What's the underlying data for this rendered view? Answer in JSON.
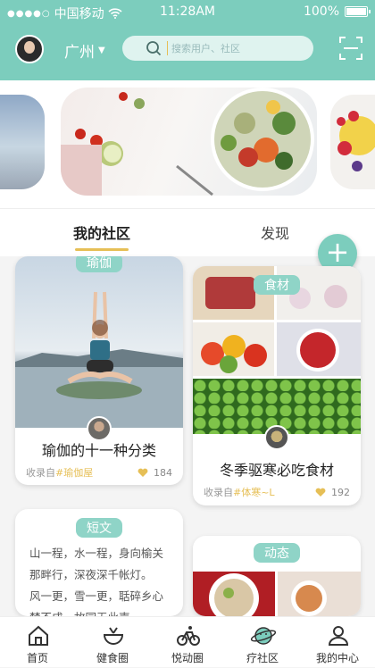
{
  "status_bar": {
    "carrier": "中国移动",
    "time": "11:28AM",
    "battery": "100%"
  },
  "header": {
    "city": "广州",
    "search_placeholder": "搜索用户、社区",
    "accent": "#7ccdbd"
  },
  "tabs": [
    {
      "label": "我的社区",
      "active": true
    },
    {
      "label": "发现",
      "active": false
    }
  ],
  "fab": {
    "icon": "plus-icon"
  },
  "cards": [
    {
      "tag": "瑜伽",
      "title": "瑜伽的十一种分类",
      "source_prefix": "收录自",
      "source_tag": "#瑜伽屋",
      "likes": "184"
    },
    {
      "tag": "食材",
      "title": "冬季驱寒必吃食材",
      "source_prefix": "收录自",
      "source_tag": "#体寒~L",
      "likes": "192"
    },
    {
      "tag": "短文",
      "lines": [
        "山一程，水一程，身向榆关",
        "那畔行，深夜深千帐灯。",
        "风一更，雪一更，聒碎乡心",
        "梦不成，故园无此声。"
      ]
    },
    {
      "tag": "动态"
    }
  ],
  "bottom_nav": [
    {
      "label": "首页",
      "icon": "home-icon"
    },
    {
      "label": "健食圈",
      "icon": "food-bowl-icon"
    },
    {
      "label": "悦动圈",
      "icon": "bicycle-icon"
    },
    {
      "label": "疗社区",
      "icon": "planet-icon",
      "active": true
    },
    {
      "label": "我的中心",
      "icon": "user-icon"
    }
  ]
}
